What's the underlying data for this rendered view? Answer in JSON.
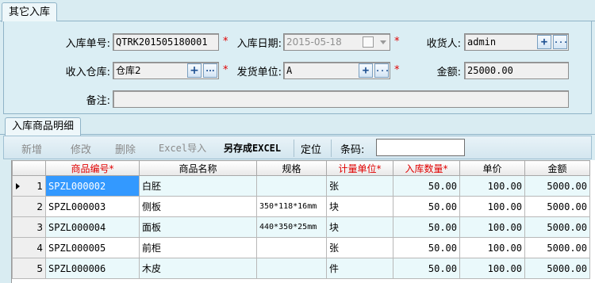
{
  "window": {
    "tab_title": "其它入库"
  },
  "form": {
    "order_no": {
      "label": "入库单号:",
      "value": "QTRK201505180001"
    },
    "date": {
      "label": "入库日期:",
      "value": "2015-05-18"
    },
    "receiver": {
      "label": "收货人:",
      "value": "admin"
    },
    "warehouse": {
      "label": "收入仓库:",
      "value": "仓库2"
    },
    "supplier": {
      "label": "发货单位:",
      "value": "A"
    },
    "amount": {
      "label": "金额:",
      "value": "25000.00"
    },
    "remark": {
      "label": "备注:",
      "value": ""
    },
    "required_mark": "*",
    "add_symbol": "+",
    "more_symbol": "..."
  },
  "detail": {
    "tab_title": "入库商品明细",
    "toolbar": {
      "new": "新增",
      "edit": "修改",
      "delete": "删除",
      "excel_import": "Excel导入",
      "save_excel": "另存成EXCEL",
      "locate": "定位",
      "barcode_label": "条码:",
      "barcode_value": ""
    },
    "columns": [
      "商品编号*",
      "商品名称",
      "规格",
      "计量单位*",
      "入库数量*",
      "单价",
      "金额"
    ],
    "rows": [
      {
        "idx": "1",
        "code": "SPZL000002",
        "name": "白胚",
        "spec": "",
        "unit": "张",
        "qty": "50.00",
        "price": "100.00",
        "amount": "5000.00"
      },
      {
        "idx": "2",
        "code": "SPZL000003",
        "name": "侧板",
        "spec": "350*118*16mm",
        "unit": "块",
        "qty": "50.00",
        "price": "100.00",
        "amount": "5000.00"
      },
      {
        "idx": "3",
        "code": "SPZL000004",
        "name": "面板",
        "spec": "440*350*25mm",
        "unit": "块",
        "qty": "50.00",
        "price": "100.00",
        "amount": "5000.00"
      },
      {
        "idx": "4",
        "code": "SPZL000005",
        "name": "前柜",
        "spec": "",
        "unit": "张",
        "qty": "50.00",
        "price": "100.00",
        "amount": "5000.00"
      },
      {
        "idx": "5",
        "code": "SPZL000006",
        "name": "木皮",
        "spec": "",
        "unit": "件",
        "qty": "50.00",
        "price": "100.00",
        "amount": "5000.00"
      }
    ]
  }
}
